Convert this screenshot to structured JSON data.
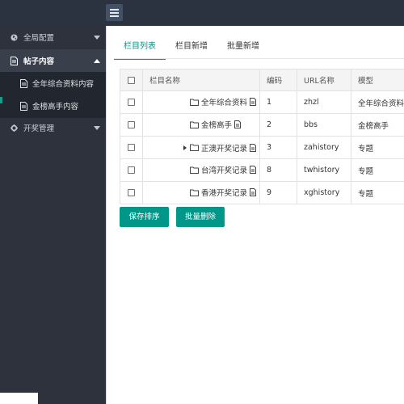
{
  "sidebar": {
    "items": [
      {
        "label": "全局配置",
        "icon": "globe-icon",
        "expanded": false
      },
      {
        "label": "帖子内容",
        "icon": "document-icon",
        "expanded": true
      },
      {
        "label": "开奖管理",
        "icon": "gear-icon",
        "expanded": false
      }
    ],
    "subitems": [
      {
        "label": "全年综合资料内容",
        "icon": "document-icon"
      },
      {
        "label": "金榜高手内容",
        "icon": "document-icon"
      }
    ]
  },
  "tabs": [
    "栏目列表",
    "栏目新增",
    "批量新增"
  ],
  "table": {
    "headers": [
      "栏目名称",
      "编码",
      "URL名称",
      "模型"
    ],
    "rows": [
      {
        "name": "全年综合资料",
        "code": "1",
        "url": "zhzl",
        "model": "全年综合资料",
        "expandable": false
      },
      {
        "name": "金榜高手",
        "code": "2",
        "url": "bbs",
        "model": "金榜高手",
        "expandable": false
      },
      {
        "name": "正澳开奖记录",
        "code": "3",
        "url": "zahistory",
        "model": "专题",
        "expandable": true
      },
      {
        "name": "台湾开奖记录",
        "code": "8",
        "url": "twhistory",
        "model": "专题",
        "expandable": false
      },
      {
        "name": "香港开奖记录",
        "code": "9",
        "url": "xghistory",
        "model": "专题",
        "expandable": false
      }
    ]
  },
  "buttons": {
    "save_sort": "保存排序",
    "batch_delete": "批量删除"
  },
  "colors": {
    "accent": "#009688",
    "topbar": "#2b3340",
    "sidebar": "#2d323d"
  }
}
